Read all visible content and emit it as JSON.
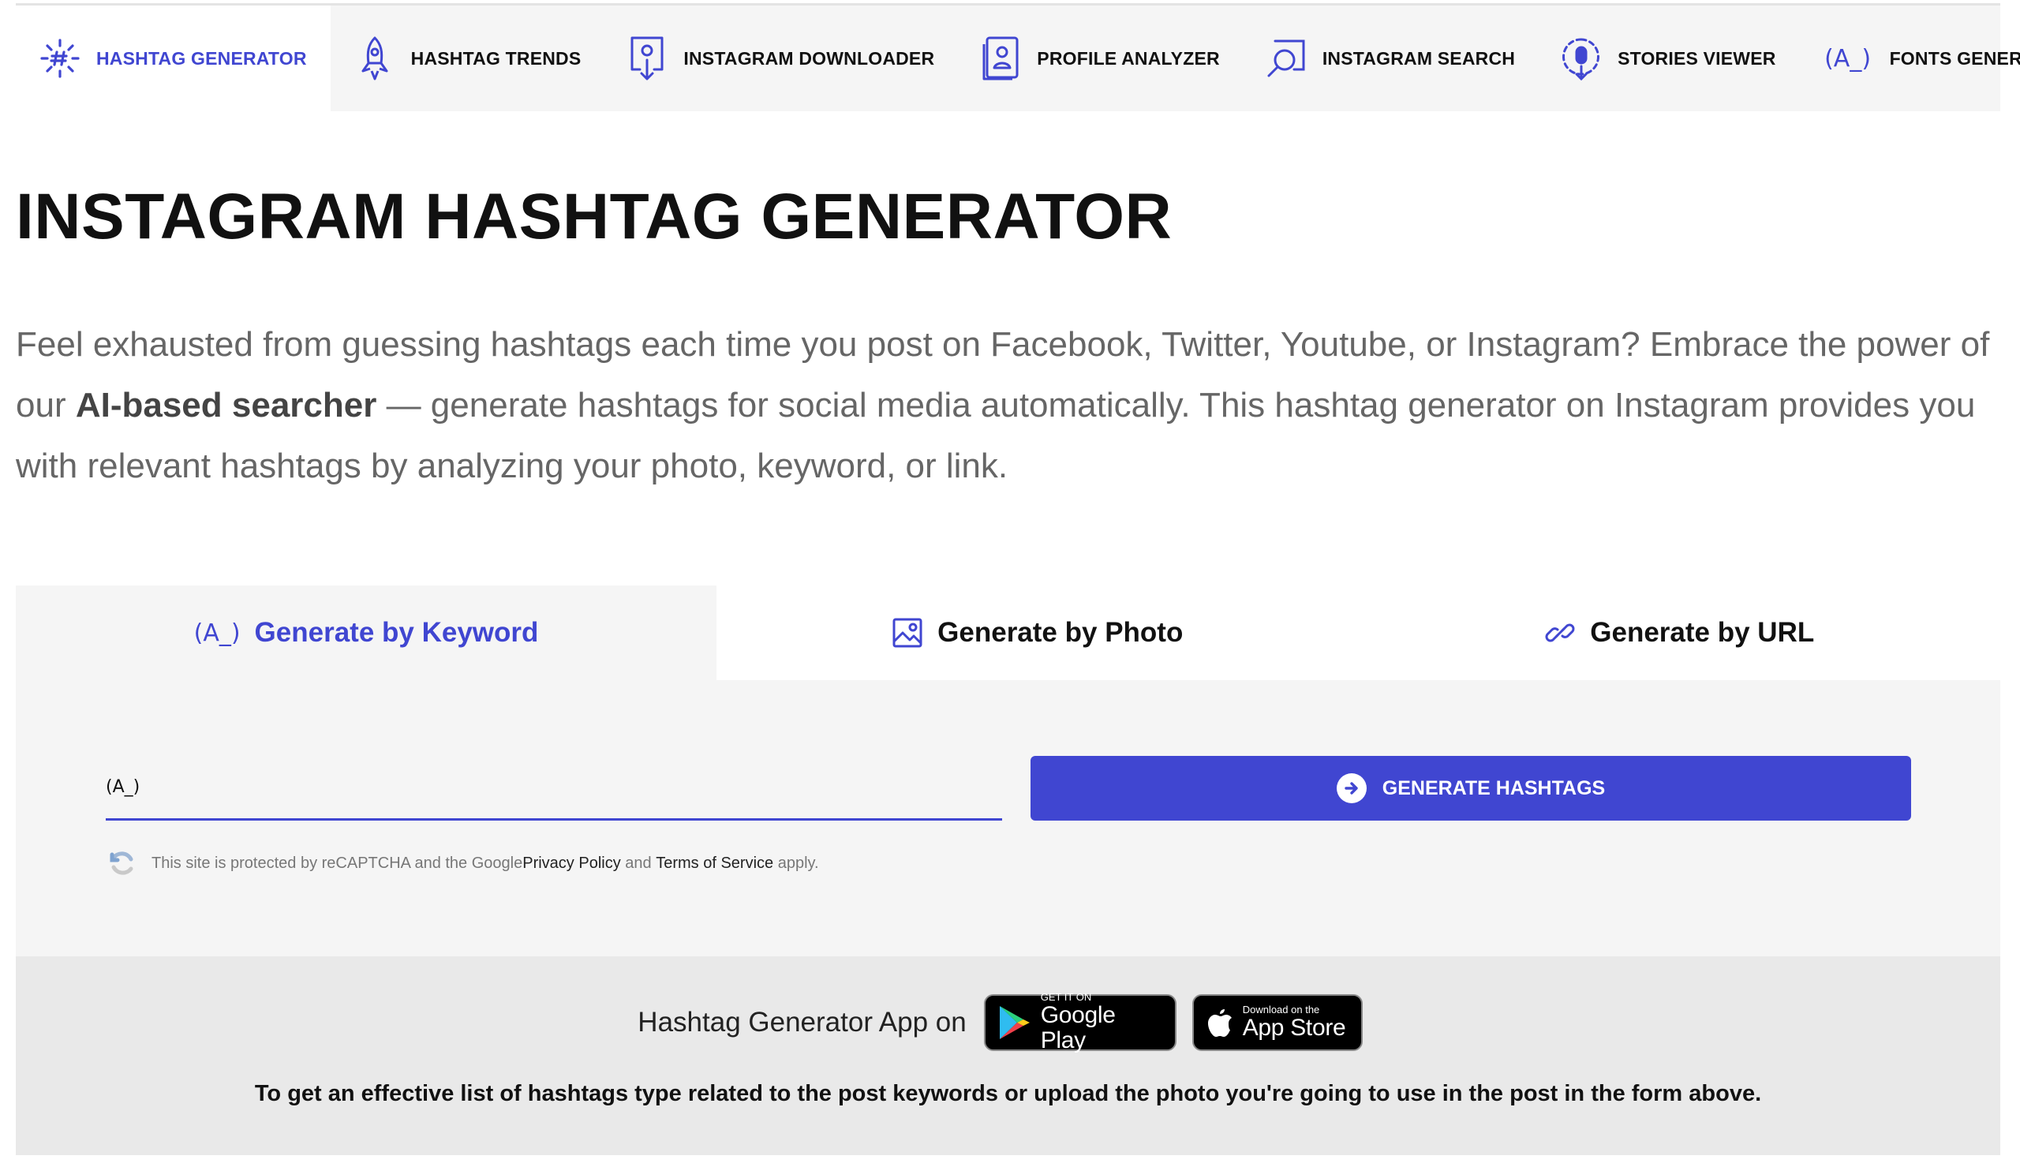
{
  "nav": {
    "items": [
      {
        "label": "HASHTAG GENERATOR",
        "icon": "hashtag-gear-icon"
      },
      {
        "label": "HASHTAG TRENDS",
        "icon": "rocket-icon"
      },
      {
        "label": "INSTAGRAM DOWNLOADER",
        "icon": "download-icon"
      },
      {
        "label": "PROFILE ANALYZER",
        "icon": "profile-card-icon"
      },
      {
        "label": "INSTAGRAM SEARCH",
        "icon": "search-icon"
      },
      {
        "label": "STORIES VIEWER",
        "icon": "stories-icon"
      },
      {
        "label": "FONTS GENERATOR",
        "icon": "font-icon"
      }
    ]
  },
  "page": {
    "title": "INSTAGRAM HASHTAG GENERATOR",
    "intro_before": "Feel exhausted from guessing hashtags each time you post on Facebook, Twitter, Youtube, or Instagram? Embrace the power of our ",
    "intro_strong": "AI-based searcher",
    "intro_after": " — generate hashtags for social media automatically. This hashtag generator on Instagram provides you with relevant hashtags by analyzing your photo, keyword, or link."
  },
  "tabs": [
    {
      "label": "Generate by Keyword",
      "icon": "font-icon"
    },
    {
      "label": "Generate by Photo",
      "icon": "image-icon"
    },
    {
      "label": "Generate by URL",
      "icon": "link-icon"
    }
  ],
  "form": {
    "input_icon_text": "(A_)",
    "input_value": "",
    "button_label": "GENERATE HASHTAGS",
    "captcha_prefix": "This site is protected by reCAPTCHA and the Google ",
    "privacy_link": "Privacy Policy",
    "captcha_and": " and ",
    "terms_link": "Terms of Service",
    "captcha_suffix": " apply."
  },
  "app": {
    "label": "Hashtag Generator App on",
    "google_small": "GET IT ON",
    "google_big": "Google Play",
    "apple_small": "Download on the",
    "apple_big": "App Store",
    "hint": "To get an effective list of hashtags type related to the post keywords or upload the photo you're going to use in the post in the form above."
  },
  "colors": {
    "accent": "#4046d1"
  }
}
